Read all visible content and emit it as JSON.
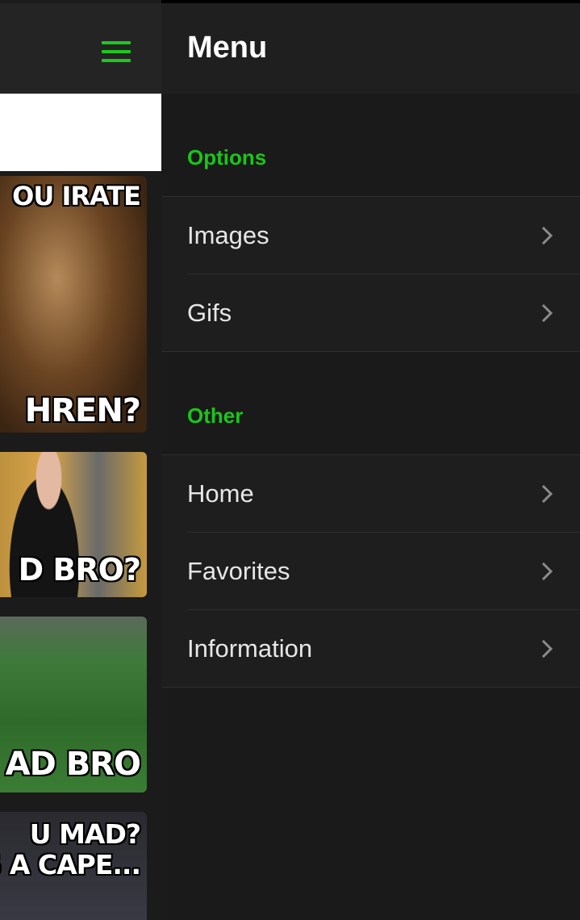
{
  "drawer": {
    "title": "Menu",
    "sections": [
      {
        "label": "Options",
        "items": [
          "Images",
          "Gifs"
        ]
      },
      {
        "label": "Other",
        "items": [
          "Home",
          "Favorites",
          "Information"
        ]
      }
    ]
  },
  "memes": [
    {
      "caption_top": "OU IRATE",
      "caption_bottom": "HREN?"
    },
    {
      "caption_bottom": "D BRO?"
    },
    {
      "caption_bottom": "AD BRO"
    },
    {
      "caption_top": "U MAD?",
      "caption_bottom": "RE'S A CAPE..."
    }
  ],
  "icons": {
    "menu": "hamburger-icon",
    "chevron": "chevron-right-icon"
  },
  "colors": {
    "accent": "#19c619",
    "drawer_bg": "#1a1a1a",
    "text": "#e6e6e6"
  }
}
